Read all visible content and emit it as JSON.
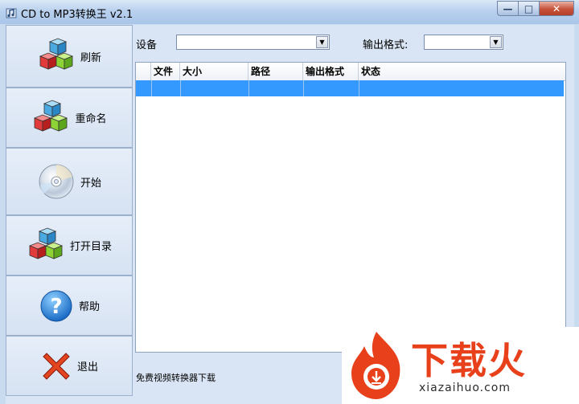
{
  "window": {
    "title": "CD to MP3转换王 v2.1",
    "controls": {
      "minimize": "—",
      "maximize": "□",
      "close": "✕"
    }
  },
  "sidebar": {
    "items": [
      {
        "label": "刷新",
        "icon": "cubes-icon"
      },
      {
        "label": "重命名",
        "icon": "cubes-icon"
      },
      {
        "label": "开始",
        "icon": "cd-disc-icon"
      },
      {
        "label": "打开目录",
        "icon": "cubes-icon"
      },
      {
        "label": "帮助",
        "icon": "help-icon"
      },
      {
        "label": "退出",
        "icon": "exit-x-icon"
      }
    ]
  },
  "toolbar": {
    "device_label": "设备",
    "device_value": "",
    "format_label": "输出格式:",
    "format_value": ""
  },
  "table": {
    "columns": [
      "文件",
      "大小",
      "路径",
      "输出格式",
      "状态"
    ],
    "rows": [
      [
        "",
        "",
        "",
        "",
        ""
      ]
    ]
  },
  "status_text": "免费视频转换器下载",
  "watermark": {
    "brand": "下载火",
    "site": "xiazaihuo.com"
  },
  "colors": {
    "selection": "#3399ff",
    "close_button": "#c7523a",
    "watermark_red": "#e8401a"
  }
}
